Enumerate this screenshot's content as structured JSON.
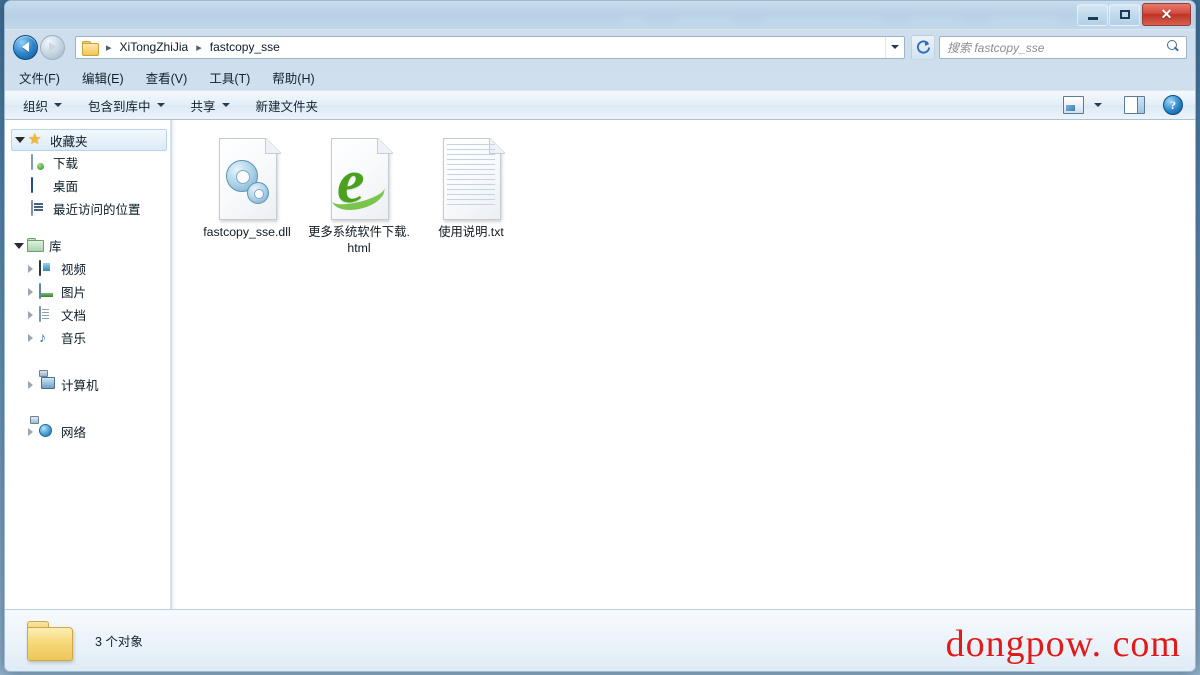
{
  "window": {
    "controls": {
      "minimize_label": "最小化",
      "maximize_label": "最大化",
      "close_label": "✕"
    }
  },
  "navbar": {
    "back_label": "后退",
    "forward_label": "前进",
    "breadcrumb": {
      "folder_icon": "folder-icon",
      "separator": "▸",
      "items": [
        {
          "label": "XiTongZhiJia"
        },
        {
          "label": "fastcopy_sse"
        }
      ]
    },
    "dropdown_label": "▾",
    "refresh_label": "刷新"
  },
  "search": {
    "placeholder": "搜索 fastcopy_sse",
    "value": "",
    "icon": "search-icon"
  },
  "menubar": {
    "items": [
      {
        "label": "文件(F)"
      },
      {
        "label": "编辑(E)"
      },
      {
        "label": "查看(V)"
      },
      {
        "label": "工具(T)"
      },
      {
        "label": "帮助(H)"
      }
    ]
  },
  "toolbar": {
    "items": [
      {
        "label": "组织",
        "has_caret": true
      },
      {
        "label": "包含到库中",
        "has_caret": true
      },
      {
        "label": "共享",
        "has_caret": true
      },
      {
        "label": "新建文件夹",
        "has_caret": false
      }
    ],
    "right": {
      "view_icon": "view-options-icon",
      "view_caret": "▾",
      "preview_pane_icon": "preview-pane-icon",
      "help_icon": "help-icon",
      "help_glyph": "?"
    }
  },
  "sidebar": {
    "groups": [
      {
        "header": {
          "label": "收藏夹",
          "icon": "star-icon",
          "expanded": true,
          "selected": true
        },
        "items": [
          {
            "label": "下载",
            "icon": "download-icon"
          },
          {
            "label": "桌面",
            "icon": "desktop-icon"
          },
          {
            "label": "最近访问的位置",
            "icon": "recent-places-icon"
          }
        ]
      },
      {
        "header": {
          "label": "库",
          "icon": "library-icon",
          "expanded": true,
          "selected": false
        },
        "items": [
          {
            "label": "视频",
            "icon": "video-icon"
          },
          {
            "label": "图片",
            "icon": "pictures-icon"
          },
          {
            "label": "文档",
            "icon": "documents-icon"
          },
          {
            "label": "音乐",
            "icon": "music-icon"
          }
        ]
      },
      {
        "header": {
          "label": "计算机",
          "icon": "computer-icon",
          "expanded": false,
          "selected": false
        },
        "items": []
      },
      {
        "header": {
          "label": "网络",
          "icon": "network-icon",
          "expanded": false,
          "selected": false
        },
        "items": []
      }
    ]
  },
  "content": {
    "files": [
      {
        "name": "fastcopy_sse.dll",
        "icon": "dll-gears-icon"
      },
      {
        "name": "更多系统软件下载.html",
        "icon": "internet-explorer-icon"
      },
      {
        "name": "使用说明.txt",
        "icon": "text-file-icon"
      }
    ]
  },
  "statusbar": {
    "folder_icon": "folder-icon",
    "text": "3 个对象"
  },
  "watermark": {
    "text": "dongpow. com"
  },
  "colors": {
    "accent": "#2b84cc",
    "close_red": "#ba3526",
    "watermark_red": "#e01b1b",
    "selection_blue": "#dceaf7",
    "ie_green": "#4aa11e"
  }
}
